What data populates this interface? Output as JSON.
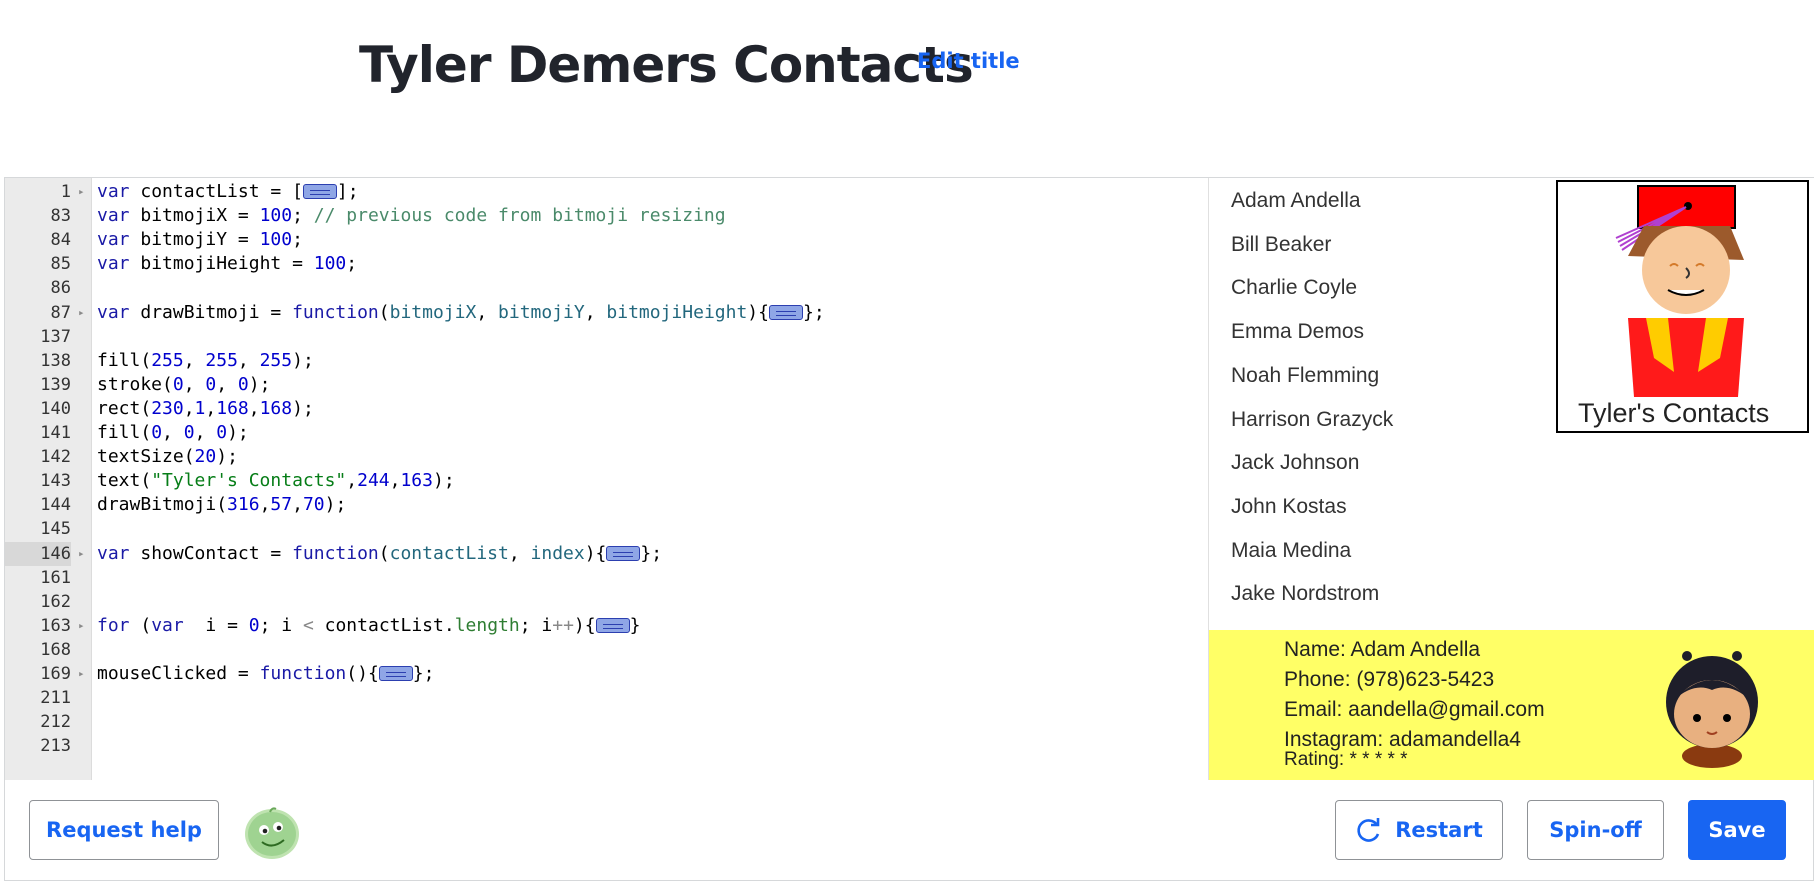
{
  "page": {
    "title": "Tyler Demers Contacts",
    "edit_title_label": "Edit title"
  },
  "editor": {
    "lines": [
      {
        "n": "1",
        "fold": true,
        "tokens": [
          [
            "kw",
            "var"
          ],
          [
            "",
            "contactList = ["
          ],
          [
            "box",
            ""
          ],
          [
            "",
            "];"
          ]
        ]
      },
      {
        "n": "83",
        "fold": false,
        "tokens": [
          [
            "kw",
            "var"
          ],
          [
            "",
            "bitmojiX = "
          ],
          [
            "num",
            "100"
          ],
          [
            "",
            "; "
          ],
          [
            "cm",
            "// previous code from bitmoji resizing"
          ]
        ]
      },
      {
        "n": "84",
        "fold": false,
        "tokens": [
          [
            "kw",
            "var"
          ],
          [
            "",
            "bitmojiY = "
          ],
          [
            "num",
            "100"
          ],
          [
            "",
            ";"
          ]
        ]
      },
      {
        "n": "85",
        "fold": false,
        "tokens": [
          [
            "kw",
            "var"
          ],
          [
            "",
            "bitmojiHeight = "
          ],
          [
            "num",
            "100"
          ],
          [
            "",
            ";"
          ]
        ]
      },
      {
        "n": "86",
        "fold": false,
        "tokens": []
      },
      {
        "n": "87",
        "fold": true,
        "tokens": [
          [
            "kw",
            "var"
          ],
          [
            "",
            "drawBitmoji = "
          ],
          [
            "kw",
            "function"
          ],
          [
            "",
            "("
          ],
          [
            "vr",
            "bitmojiX"
          ],
          [
            "",
            ", "
          ],
          [
            "vr",
            "bitmojiY"
          ],
          [
            "",
            ", "
          ],
          [
            "vr",
            "bitmojiHeight"
          ],
          [
            "",
            "){"
          ],
          [
            "box",
            ""
          ],
          [
            "",
            "};"
          ]
        ]
      },
      {
        "n": "137",
        "fold": false,
        "tokens": []
      },
      {
        "n": "138",
        "fold": false,
        "tokens": [
          [
            "",
            "fill("
          ],
          [
            "num",
            "255"
          ],
          [
            "",
            ", "
          ],
          [
            "num",
            "255"
          ],
          [
            "",
            ", "
          ],
          [
            "num",
            "255"
          ],
          [
            "",
            ");"
          ]
        ]
      },
      {
        "n": "139",
        "fold": false,
        "tokens": [
          [
            "",
            "stroke("
          ],
          [
            "num",
            "0"
          ],
          [
            "",
            ", "
          ],
          [
            "num",
            "0"
          ],
          [
            "",
            ", "
          ],
          [
            "num",
            "0"
          ],
          [
            "",
            ");"
          ]
        ]
      },
      {
        "n": "140",
        "fold": false,
        "tokens": [
          [
            "",
            "rect("
          ],
          [
            "num",
            "230"
          ],
          [
            "",
            ","
          ],
          [
            "num",
            "1"
          ],
          [
            "",
            ","
          ],
          [
            "num",
            "168"
          ],
          [
            "",
            ","
          ],
          [
            "num",
            "168"
          ],
          [
            "",
            ");"
          ]
        ]
      },
      {
        "n": "141",
        "fold": false,
        "tokens": [
          [
            "",
            "fill("
          ],
          [
            "num",
            "0"
          ],
          [
            "",
            ", "
          ],
          [
            "num",
            "0"
          ],
          [
            "",
            ", "
          ],
          [
            "num",
            "0"
          ],
          [
            "",
            ");"
          ]
        ]
      },
      {
        "n": "142",
        "fold": false,
        "tokens": [
          [
            "",
            "textSize("
          ],
          [
            "num",
            "20"
          ],
          [
            "",
            ");"
          ]
        ]
      },
      {
        "n": "143",
        "fold": false,
        "tokens": [
          [
            "",
            "text("
          ],
          [
            "str",
            "\"Tyler's Contacts\""
          ],
          [
            "",
            ","
          ],
          [
            "num",
            "244"
          ],
          [
            "",
            ","
          ],
          [
            "num",
            "163"
          ],
          [
            "",
            ");"
          ]
        ]
      },
      {
        "n": "144",
        "fold": false,
        "tokens": [
          [
            "",
            "drawBitmoji("
          ],
          [
            "num",
            "316"
          ],
          [
            "",
            ","
          ],
          [
            "num",
            "57"
          ],
          [
            "",
            ","
          ],
          [
            "num",
            "70"
          ],
          [
            "",
            ");"
          ]
        ]
      },
      {
        "n": "145",
        "fold": false,
        "tokens": []
      },
      {
        "n": "146",
        "fold": true,
        "active": true,
        "tokens": [
          [
            "kw",
            "var"
          ],
          [
            "",
            "showContact = "
          ],
          [
            "kw",
            "function"
          ],
          [
            "",
            "("
          ],
          [
            "vr",
            "contactList"
          ],
          [
            "",
            ", "
          ],
          [
            "vr",
            "index"
          ],
          [
            "",
            "){"
          ],
          [
            "box",
            ""
          ],
          [
            "",
            "};"
          ]
        ]
      },
      {
        "n": "161",
        "fold": false,
        "tokens": []
      },
      {
        "n": "162",
        "fold": false,
        "tokens": []
      },
      {
        "n": "163",
        "fold": true,
        "tokens": [
          [
            "kw",
            "for"
          ],
          [
            "",
            " ("
          ],
          [
            "kw",
            "var"
          ],
          [
            "",
            ""
          ],
          [
            "",
            " i = "
          ],
          [
            "num",
            "0"
          ],
          [
            "",
            "; i "
          ],
          [
            "op",
            "<"
          ],
          [
            "",
            ""
          ],
          [
            "",
            " contactList."
          ],
          [
            "pr",
            "length"
          ],
          [
            "",
            "; i"
          ],
          [
            "op",
            "++"
          ],
          [
            "",
            "){"
          ],
          [
            "box",
            ""
          ],
          [
            "",
            "}"
          ]
        ]
      },
      {
        "n": "168",
        "fold": false,
        "tokens": []
      },
      {
        "n": "169",
        "fold": true,
        "tokens": [
          [
            "",
            "mouseClicked = "
          ],
          [
            "kw",
            "function"
          ],
          [
            "",
            "(){"
          ],
          [
            "box",
            ""
          ],
          [
            "",
            "};"
          ]
        ]
      },
      {
        "n": "211",
        "fold": false,
        "tokens": []
      },
      {
        "n": "212",
        "fold": false,
        "tokens": []
      },
      {
        "n": "213",
        "fold": false,
        "tokens": []
      }
    ]
  },
  "canvas": {
    "contacts": [
      "Adam Andella",
      "Bill Beaker",
      "Charlie Coyle",
      "Emma Demos",
      "Noah Flemming",
      "Harrison Grazyck",
      "Jack Johnson",
      "John Kostas",
      "Maia Medina",
      "Jake Nordstrom"
    ],
    "logo_text": "Tyler's Contacts",
    "detail": {
      "name": "Name: Adam Andella",
      "phone": "Phone: (978)623-5423",
      "email": "Email: aandella@gmail.com",
      "instagram": "Instagram: adamandella4",
      "rating": "Rating: * * * * *"
    },
    "colors": {
      "detail_bg": "#ffff66",
      "hat": "#ff0000",
      "jacket": "#ff1a1a",
      "vest": "#ffcc00",
      "skin": "#f7c89a"
    }
  },
  "footer": {
    "request_help": "Request help",
    "restart": "Restart",
    "spin_off": "Spin-off",
    "save": "Save"
  }
}
